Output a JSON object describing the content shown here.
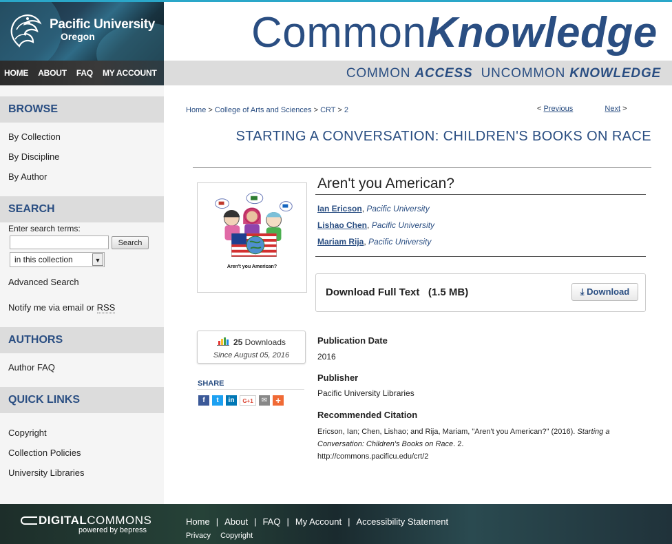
{
  "header": {
    "logo_title": "Pacific University",
    "logo_sub": "Oregon",
    "site_title_a": "Common",
    "site_title_b": "Knowledge",
    "tagline": [
      "COMMON",
      "ACCESS",
      "UNCOMMON",
      "KNOWLEDGE"
    ],
    "nav": [
      "HOME",
      "ABOUT",
      "FAQ",
      "MY ACCOUNT"
    ]
  },
  "sidebar": {
    "browse_head": "BROWSE",
    "browse": [
      "By Collection",
      "By Discipline",
      "By Author"
    ],
    "search_head": "SEARCH",
    "search_label": "Enter search terms:",
    "search_value": "",
    "search_button": "Search",
    "scope": "in this collection",
    "advanced": "Advanced Search",
    "notify": "Notify me via email or ",
    "rss": "RSS",
    "authors_head": "AUTHORS",
    "author_faq": "Author FAQ",
    "quick_head": "QUICK LINKS",
    "quick": [
      "Copyright",
      "Collection Policies",
      "University Libraries"
    ]
  },
  "breadcrumb": [
    "Home",
    "College of Arts and Sciences",
    "CRT",
    "2"
  ],
  "breadcrumb_sep": ">",
  "pager": {
    "prev": "Previous",
    "next": "Next",
    "prev_arrow": "<",
    "next_arrow": ">"
  },
  "series_title": "STARTING A CONVERSATION: CHILDREN'S BOOKS ON RACE",
  "cover_caption": "Aren't you American?",
  "item": {
    "title": "Aren't you American?",
    "authors": [
      {
        "name": "Ian Ericson",
        "affiliation": "Pacific University"
      },
      {
        "name": "Lishao Chen",
        "affiliation": "Pacific University"
      },
      {
        "name": "Mariam Rija",
        "affiliation": "Pacific University"
      }
    ],
    "author_sep": ", "
  },
  "download": {
    "label": "Download Full Text",
    "size": "(1.5 MB)",
    "button": "Download"
  },
  "metrics": {
    "count": "25",
    "unit": "Downloads",
    "since": "Since August 05, 2016"
  },
  "share": {
    "label": "SHARE",
    "buttons": [
      "f",
      "t",
      "in",
      "G+1",
      "✉",
      "+"
    ]
  },
  "fields": {
    "pubdate_label": "Publication Date",
    "pubdate": "2016",
    "publisher_label": "Publisher",
    "publisher": "Pacific University Libraries",
    "citation_label": "Recommended Citation",
    "citation_a": "Ericson, Ian; Chen, Lishao; and Rija, Mariam, \"Aren't you American?\" (2016). ",
    "citation_series": "Starting a Conversation: Children's Books on Race",
    "citation_b": ". 2.",
    "citation_url": "http://commons.pacificu.edu/crt/2"
  },
  "footer": {
    "logo_a": "DIGITAL",
    "logo_b": "COMMONS",
    "powered": "powered by bepress",
    "links": [
      "Home",
      "About",
      "FAQ",
      "My Account",
      "Accessibility Statement"
    ],
    "links_sep": "|",
    "links2": [
      "Privacy",
      "Copyright"
    ]
  },
  "colors": {
    "brand_blue": "#2a4e82",
    "header_gray": "#dcdcdc",
    "sidebar_bg": "#f5f5f5"
  }
}
